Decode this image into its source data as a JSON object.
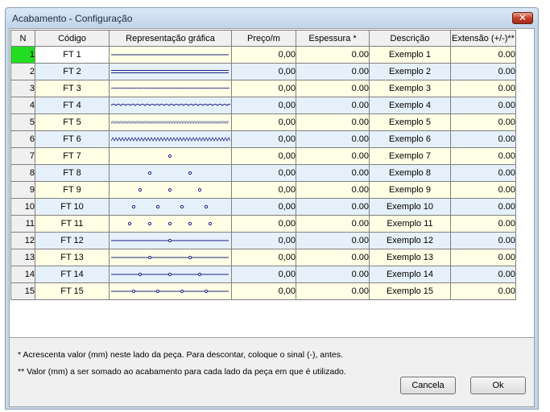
{
  "window": {
    "title": "Acabamento - Configuração",
    "close_symbol": "✕"
  },
  "grid": {
    "headers": {
      "n": "N",
      "codigo": "Código",
      "representacao": "Representação gráfica",
      "preco": "Preço/m",
      "espessura": "Espessura *",
      "descricao": "Descrição",
      "extensao": "Extensão (+/-)**"
    },
    "rows": [
      {
        "n": "1",
        "codigo": "FT 1",
        "pattern": "thin-line",
        "preco": "0,00",
        "espessura": "0.00",
        "descricao": "Exemplo 1",
        "extensao": "0.00"
      },
      {
        "n": "2",
        "codigo": "FT 2",
        "pattern": "double-line",
        "preco": "0,00",
        "espessura": "0.00",
        "descricao": "Exemplo 2",
        "extensao": "0.00"
      },
      {
        "n": "3",
        "codigo": "FT 3",
        "pattern": "fine-wave",
        "preco": "0,00",
        "espessura": "0.00",
        "descricao": "Exemplo 3",
        "extensao": "0.00"
      },
      {
        "n": "4",
        "codigo": "FT 4",
        "pattern": "wave",
        "preco": "0,00",
        "espessura": "0.00",
        "descricao": "Exemplo 4",
        "extensao": "0.00"
      },
      {
        "n": "5",
        "codigo": "FT 5",
        "pattern": "hatch",
        "preco": "0,00",
        "espessura": "0.00",
        "descricao": "Exemplo 5",
        "extensao": "0.00"
      },
      {
        "n": "6",
        "codigo": "FT 6",
        "pattern": "zigzag",
        "preco": "0,00",
        "espessura": "0.00",
        "descricao": "Exemplo 6",
        "extensao": "0.00"
      },
      {
        "n": "7",
        "codigo": "FT 7",
        "pattern": "dots-1",
        "preco": "0,00",
        "espessura": "0.00",
        "descricao": "Exemplo 7",
        "extensao": "0.00"
      },
      {
        "n": "8",
        "codigo": "FT 8",
        "pattern": "dots-2",
        "preco": "0,00",
        "espessura": "0.00",
        "descricao": "Exemplo 8",
        "extensao": "0.00"
      },
      {
        "n": "9",
        "codigo": "FT 9",
        "pattern": "dots-3",
        "preco": "0,00",
        "espessura": "0.00",
        "descricao": "Exemplo 9",
        "extensao": "0.00"
      },
      {
        "n": "10",
        "codigo": "FT 10",
        "pattern": "dots-4",
        "preco": "0,00",
        "espessura": "0.00",
        "descricao": "Exemplo 10",
        "extensao": "0.00"
      },
      {
        "n": "11",
        "codigo": "FT 11",
        "pattern": "dots-5",
        "preco": "0,00",
        "espessura": "0.00",
        "descricao": "Exemplo 11",
        "extensao": "0.00"
      },
      {
        "n": "12",
        "codigo": "FT 12",
        "pattern": "line-dots-1",
        "preco": "0,00",
        "espessura": "0.00",
        "descricao": "Exemplo 12",
        "extensao": "0.00"
      },
      {
        "n": "13",
        "codigo": "FT 13",
        "pattern": "line-dots-2",
        "preco": "0,00",
        "espessura": "0.00",
        "descricao": "Exemplo 13",
        "extensao": "0.00"
      },
      {
        "n": "14",
        "codigo": "FT 14",
        "pattern": "line-dots-3",
        "preco": "0,00",
        "espessura": "0.00",
        "descricao": "Exemplo 14",
        "extensao": "0.00"
      },
      {
        "n": "15",
        "codigo": "FT 15",
        "pattern": "line-dots-4",
        "preco": "0,00",
        "espessura": "0.00",
        "descricao": "Exemplo 15",
        "extensao": "0.00"
      }
    ]
  },
  "notes": {
    "note1": "* Acrescenta valor (mm) neste lado da peça. Para descontar, coloque o sinal (-), antes.",
    "note2": "** Valor (mm) a ser somado ao acabamento para cada lado da peça em que é utilizado."
  },
  "buttons": {
    "cancel": "Cancela",
    "ok": "Ok"
  },
  "colors": {
    "selected_row_header": "#22dd22",
    "row_yellow": "#ffffe6",
    "row_blue": "#e6f0fa",
    "line_blue": "#1a237e"
  }
}
